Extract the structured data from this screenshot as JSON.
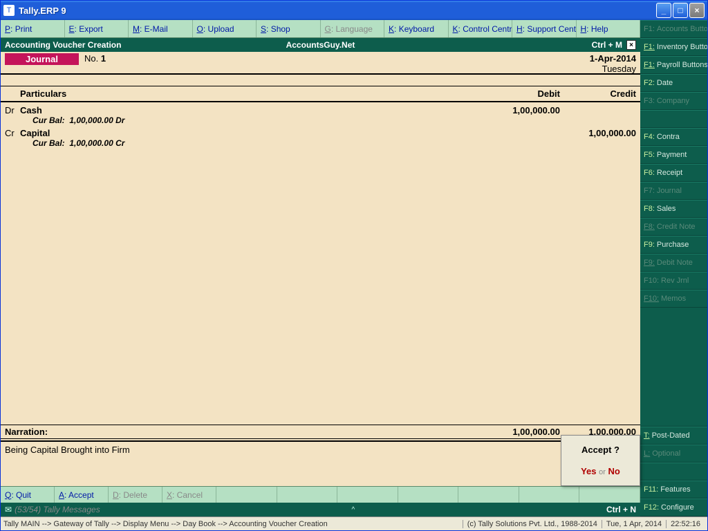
{
  "window": {
    "title": "Tally.ERP 9"
  },
  "menubar": [
    {
      "key": "P",
      "label": "Print",
      "disabled": false
    },
    {
      "key": "E",
      "label": "Export",
      "disabled": false
    },
    {
      "key": "M",
      "label": "E-Mail",
      "disabled": false
    },
    {
      "key": "O",
      "label": "Upload",
      "disabled": false
    },
    {
      "key": "S",
      "label": "Shop",
      "disabled": false
    },
    {
      "key": "G",
      "label": "Language",
      "disabled": true
    },
    {
      "key": "K",
      "label": "Keyboard",
      "disabled": false
    },
    {
      "key": "K",
      "label": "Control Centre",
      "disabled": false
    },
    {
      "key": "H",
      "label": "Support Centre",
      "disabled": false
    },
    {
      "key": "H",
      "label": "Help",
      "disabled": false
    }
  ],
  "voucher_head": {
    "left": "Accounting Voucher  Creation",
    "center": "AccountsGuy.Net",
    "right": "Ctrl + M"
  },
  "voucher_sub": {
    "type": "Journal",
    "no_label": "No.",
    "no": "1",
    "date": "1-Apr-2014",
    "day": "Tuesday"
  },
  "grid": {
    "headers": {
      "particulars": "Particulars",
      "debit": "Debit",
      "credit": "Credit"
    },
    "lines": [
      {
        "dc": "Dr",
        "account": "Cash",
        "curbal_label": "Cur Bal:",
        "curbal": "1,00,000.00 Dr",
        "debit": "1,00,000.00",
        "credit": ""
      },
      {
        "dc": "Cr",
        "account": "Capital",
        "curbal_label": "Cur Bal:",
        "curbal": "1,00,000.00 Cr",
        "debit": "",
        "credit": "1,00,000.00"
      }
    ],
    "totals": {
      "debit": "1,00,000.00",
      "credit": "1,00,000.00"
    }
  },
  "narration": {
    "label": "Narration:",
    "text": "Being Capital Brought into Firm"
  },
  "accept": {
    "title": "Accept ?",
    "yes": "Yes",
    "or": "or",
    "no": "No"
  },
  "bottombar": [
    {
      "key": "Q",
      "label": "Quit",
      "disabled": false
    },
    {
      "key": "A",
      "label": "Accept",
      "disabled": false
    },
    {
      "key": "D",
      "label": "Delete",
      "disabled": true
    },
    {
      "key": "X",
      "label": "Cancel",
      "disabled": true
    }
  ],
  "msgbar": {
    "count": "(53/54)",
    "label": "Tally Messages",
    "right": "Ctrl + N"
  },
  "breadcrumb": {
    "path": "Tally MAIN --> Gateway of Tally --> Display Menu --> Day Book --> Accounting Voucher  Creation",
    "copyright": "(c) Tally Solutions Pvt. Ltd., 1988-2014",
    "date": "Tue, 1 Apr, 2014",
    "time": "22:52:16"
  },
  "sidebar": [
    {
      "fk": "F1",
      "label": "Accounts Buttons",
      "disabled": true,
      "ul": false
    },
    {
      "fk": "F1",
      "label": "Inventory Buttons",
      "disabled": false,
      "ul": true
    },
    {
      "fk": "F1",
      "label": "Payroll Buttons",
      "disabled": false,
      "ul": true
    },
    {
      "fk": "F2",
      "label": "Date",
      "disabled": false,
      "ul": false
    },
    {
      "fk": "F3",
      "label": "Company",
      "disabled": true,
      "ul": false
    },
    {
      "fk": "",
      "label": "",
      "disabled": true,
      "ul": false
    },
    {
      "fk": "F4",
      "label": "Contra",
      "disabled": false,
      "ul": false
    },
    {
      "fk": "F5",
      "label": "Payment",
      "disabled": false,
      "ul": false
    },
    {
      "fk": "F6",
      "label": "Receipt",
      "disabled": false,
      "ul": false
    },
    {
      "fk": "F7",
      "label": "Journal",
      "disabled": true,
      "ul": false
    },
    {
      "fk": "F8",
      "label": "Sales",
      "disabled": false,
      "ul": false
    },
    {
      "fk": "F8",
      "label": "Credit Note",
      "disabled": true,
      "ul": true
    },
    {
      "fk": "F9",
      "label": "Purchase",
      "disabled": false,
      "ul": false
    },
    {
      "fk": "F9",
      "label": "Debit Note",
      "disabled": true,
      "ul": true
    },
    {
      "fk": "F10",
      "label": "Rev Jrnl",
      "disabled": true,
      "ul": false
    },
    {
      "fk": "F10",
      "label": "Memos",
      "disabled": true,
      "ul": true
    }
  ],
  "sidebar_bottom": [
    {
      "fk": "T",
      "label": "Post-Dated",
      "disabled": false,
      "ul": true
    },
    {
      "fk": "L",
      "label": "Optional",
      "disabled": true,
      "ul": true
    },
    {
      "fk": "",
      "label": "",
      "disabled": true,
      "ul": false
    },
    {
      "fk": "F11",
      "label": "Features",
      "disabled": false,
      "ul": false
    },
    {
      "fk": "F12",
      "label": "Configure",
      "disabled": false,
      "ul": false
    }
  ]
}
